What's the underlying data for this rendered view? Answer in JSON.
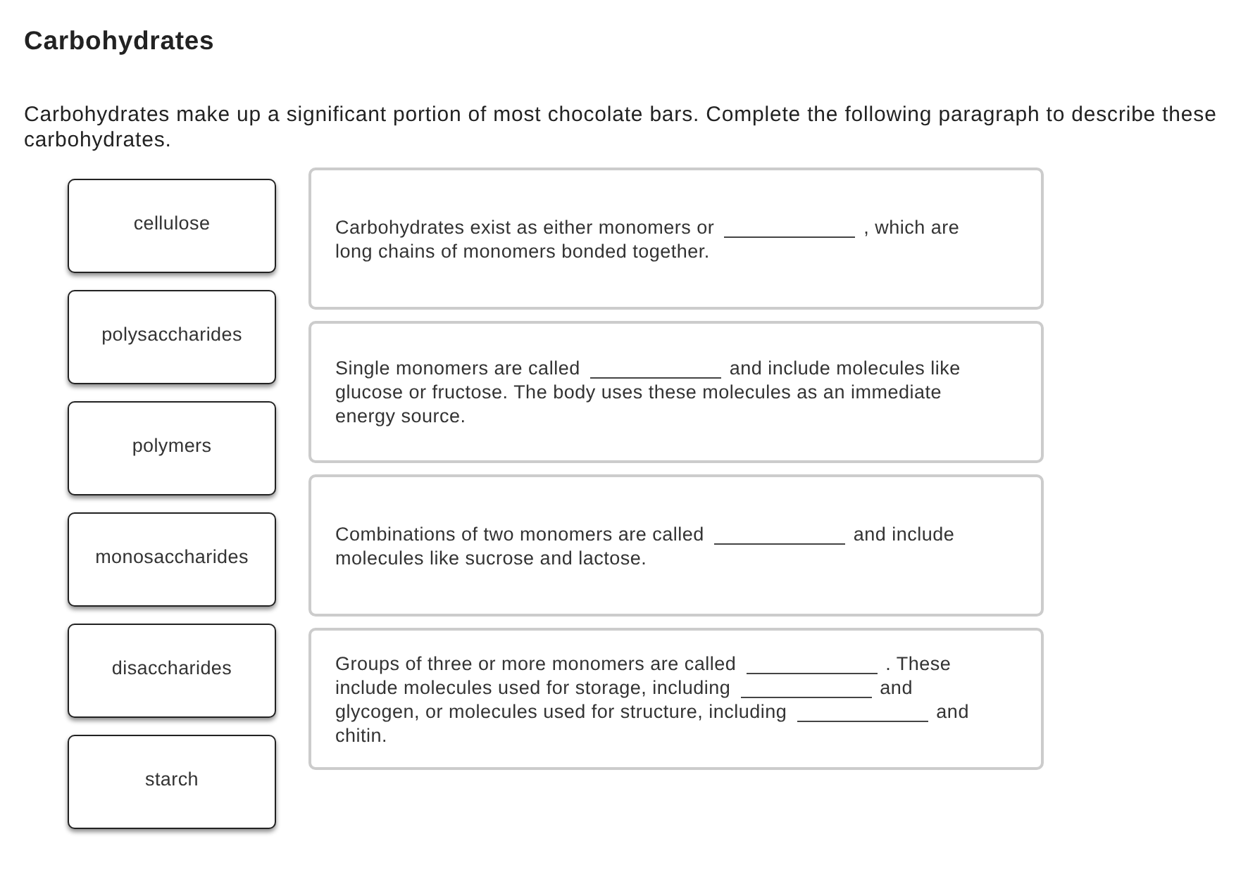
{
  "title": "Carbohydrates",
  "instructions": "Carbohydrates make up a significant portion of most chocolate bars. Complete the following paragraph to describe these carbohydrates.",
  "answer_tiles": [
    "cellulose",
    "polysaccharides",
    "polymers",
    "monosaccharides",
    "disaccharides",
    "starch"
  ],
  "statements": [
    {
      "lines": [
        [
          {
            "kind": "text",
            "text": "Carbohydrates exist as either monomers or"
          },
          {
            "kind": "blank"
          },
          {
            "kind": "text",
            "text": ", which are"
          }
        ],
        [
          {
            "kind": "text",
            "text": "long chains of monomers bonded together."
          }
        ]
      ]
    },
    {
      "lines": [
        [
          {
            "kind": "text",
            "text": "Single monomers are called"
          },
          {
            "kind": "blank"
          },
          {
            "kind": "text",
            "text": "and include molecules like"
          }
        ],
        [
          {
            "kind": "text",
            "text": "glucose or fructose. The body uses these molecules as an immediate"
          }
        ],
        [
          {
            "kind": "text",
            "text": "energy source."
          }
        ]
      ]
    },
    {
      "lines": [
        [
          {
            "kind": "text",
            "text": "Combinations of two monomers are called"
          },
          {
            "kind": "blank"
          },
          {
            "kind": "text",
            "text": "and include"
          }
        ],
        [
          {
            "kind": "text",
            "text": "molecules like sucrose and lactose."
          }
        ]
      ]
    },
    {
      "lines": [
        [
          {
            "kind": "text",
            "text": "Groups of three or more monomers are called"
          },
          {
            "kind": "blank"
          },
          {
            "kind": "text",
            "text": ". These"
          }
        ],
        [
          {
            "kind": "text",
            "text": "include molecules used for storage, including"
          },
          {
            "kind": "blank"
          },
          {
            "kind": "text",
            "text": "and"
          }
        ],
        [
          {
            "kind": "text",
            "text": "glycogen, or molecules used for structure, including"
          },
          {
            "kind": "blank"
          },
          {
            "kind": "text",
            "text": "and"
          }
        ],
        [
          {
            "kind": "text",
            "text": "chitin."
          }
        ]
      ]
    }
  ]
}
